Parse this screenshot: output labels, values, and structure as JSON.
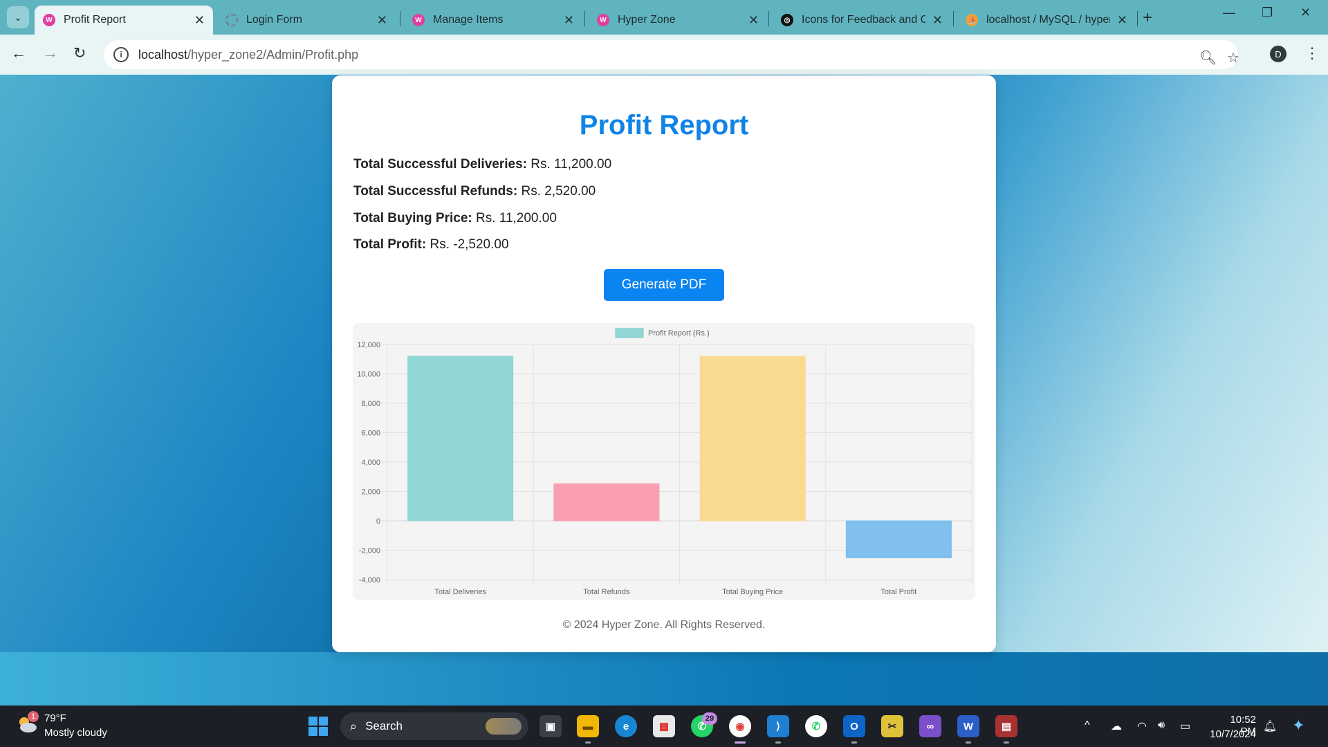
{
  "browser": {
    "tabs": [
      {
        "label": "Profit Report",
        "favicon_color": "#e03fa0",
        "active": true
      },
      {
        "label": "Login Form",
        "favicon_color": "#6b7b7e",
        "active": false
      },
      {
        "label": "Manage Items",
        "favicon_color": "#e03fa0",
        "active": false
      },
      {
        "label": "Hyper Zone",
        "favicon_color": "#e03fa0",
        "active": false
      },
      {
        "label": "Icons for Feedback and Co",
        "favicon_color": "#111111",
        "active": false
      },
      {
        "label": "localhost / MySQL / hyper",
        "favicon_color": "#e8a23a",
        "active": false
      }
    ],
    "url_host": "localhost",
    "url_path": "/hyper_zone2/Admin/Profit.php",
    "profile_initial": "D"
  },
  "page": {
    "title": "Profit Report",
    "stats": [
      {
        "label": "Total Successful Deliveries:",
        "value": "Rs. 11,200.00"
      },
      {
        "label": "Total Successful Refunds:",
        "value": "Rs. 2,520.00"
      },
      {
        "label": "Total Buying Price:",
        "value": "Rs. 11,200.00"
      },
      {
        "label": "Total Profit:",
        "value": "Rs. -2,520.00"
      }
    ],
    "generate_button": "Generate PDF",
    "footer": "© 2024 Hyper Zone. All Rights Reserved."
  },
  "chart_data": {
    "type": "bar",
    "legend": "Profit Report (Rs.)",
    "legend_position": "top",
    "categories": [
      "Total Deliveries",
      "Total Refunds",
      "Total Buying Price",
      "Total Profit"
    ],
    "values": [
      11200,
      2520,
      11200,
      -2520
    ],
    "colors": [
      "#91d5d5",
      "#f99fb1",
      "#f9da90",
      "#80bfee"
    ],
    "ylim": [
      -4000,
      12000
    ],
    "yticks": [
      "12,000",
      "10,000",
      "8,000",
      "6,000",
      "4,000",
      "2,000",
      "0",
      "-2,000",
      "-4,000"
    ],
    "ytick_values": [
      12000,
      10000,
      8000,
      6000,
      4000,
      2000,
      0,
      -2000,
      -4000
    ],
    "grid": true
  },
  "taskbar": {
    "weather_temp": "79°F",
    "weather_desc": "Mostly cloudy",
    "weather_badge": "1",
    "search_label": "Search",
    "whatsapp_badge": "29",
    "time": "10:52 PM",
    "date": "10/7/2024"
  }
}
